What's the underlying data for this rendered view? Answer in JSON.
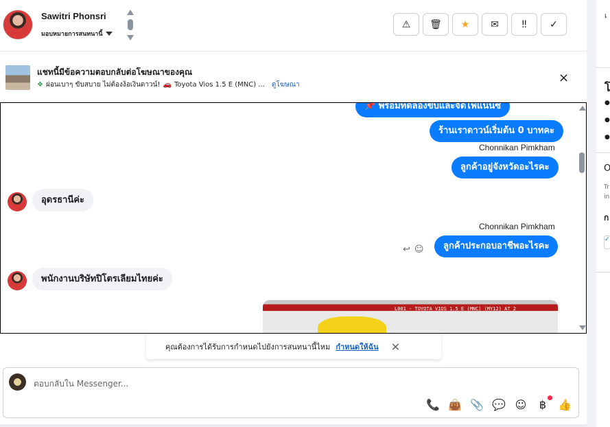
{
  "header": {
    "contact_name": "Sawitri Phonsri",
    "assign_label": "มอบหมายการสนทนานี้",
    "actions": [
      {
        "name": "report-spam-button",
        "icon": "warning-icon",
        "glyph": "⚠"
      },
      {
        "name": "delete-button",
        "icon": "trash-icon",
        "glyph": "🗑"
      },
      {
        "name": "star-button",
        "icon": "star-icon",
        "glyph": "★"
      },
      {
        "name": "mark-unread-button",
        "icon": "envelope-open-icon",
        "glyph": "✉"
      },
      {
        "name": "follow-up-button",
        "icon": "priority-icon",
        "glyph": "‼"
      },
      {
        "name": "mark-done-button",
        "icon": "check-icon",
        "glyph": "✓"
      }
    ]
  },
  "ad_banner": {
    "title": "แชทนี้มีข้อความตอบกลับต่อโฆษณาของคุณ",
    "sub_text_1": "ผ่อนเบาๆ ขับสบาย ไม่ต้องง้อเงินดาวน์!",
    "sub_text_2": "Toyota Vios 1.5 E (MNC) ...",
    "link": "ดูโฆษณา",
    "close": "×"
  },
  "messages": {
    "out_1": "📌 พร้อมทดลองขับและจัดไฟแนนซ์",
    "out_2": "ร้านเราดาวน์เริ่มต้น 0 บาทคะ",
    "sender_1": "Chonnikan Pimkham",
    "out_3": "ลูกค้าอยู่จังหวัดอะไรคะ",
    "in_1": "อุดรธานีค่ะ",
    "sender_2": "Chonnikan Pimkham",
    "out_4": "ลูกค้าประกอบอาชีพอะไรคะ",
    "in_2": "พนักงานบริษัทปิโตรเลียมไทยค่ะ",
    "media_caption": "L001 - TOYOTA VIOS 1.5 E (MNC) (MY12) AT 2",
    "reply_icon": "↩",
    "react_icon": "☺"
  },
  "toast": {
    "text": "คุณต้องการได้รับการกำหนดไปยังการสนทนานี้ไหม",
    "link": "กำหนดให้ฉัน",
    "close": "✕"
  },
  "composer": {
    "placeholder": "ตอบกลับใน Messenger...",
    "tools": [
      {
        "name": "call-icon",
        "glyph": "📞"
      },
      {
        "name": "shopping-bag-icon",
        "glyph": "👜"
      },
      {
        "name": "attachment-icon",
        "glyph": "📎"
      },
      {
        "name": "saved-reply-icon",
        "glyph": "💬"
      },
      {
        "name": "emoji-icon",
        "glyph": "☺"
      },
      {
        "name": "payment-icon",
        "glyph": "฿"
      },
      {
        "name": "like-icon",
        "glyph": "👍"
      }
    ]
  },
  "right_panel": {
    "t1": "เ",
    "t2": "โ",
    "t3": "O",
    "t4": "Tr",
    "t5": "in",
    "t6": "ก"
  }
}
